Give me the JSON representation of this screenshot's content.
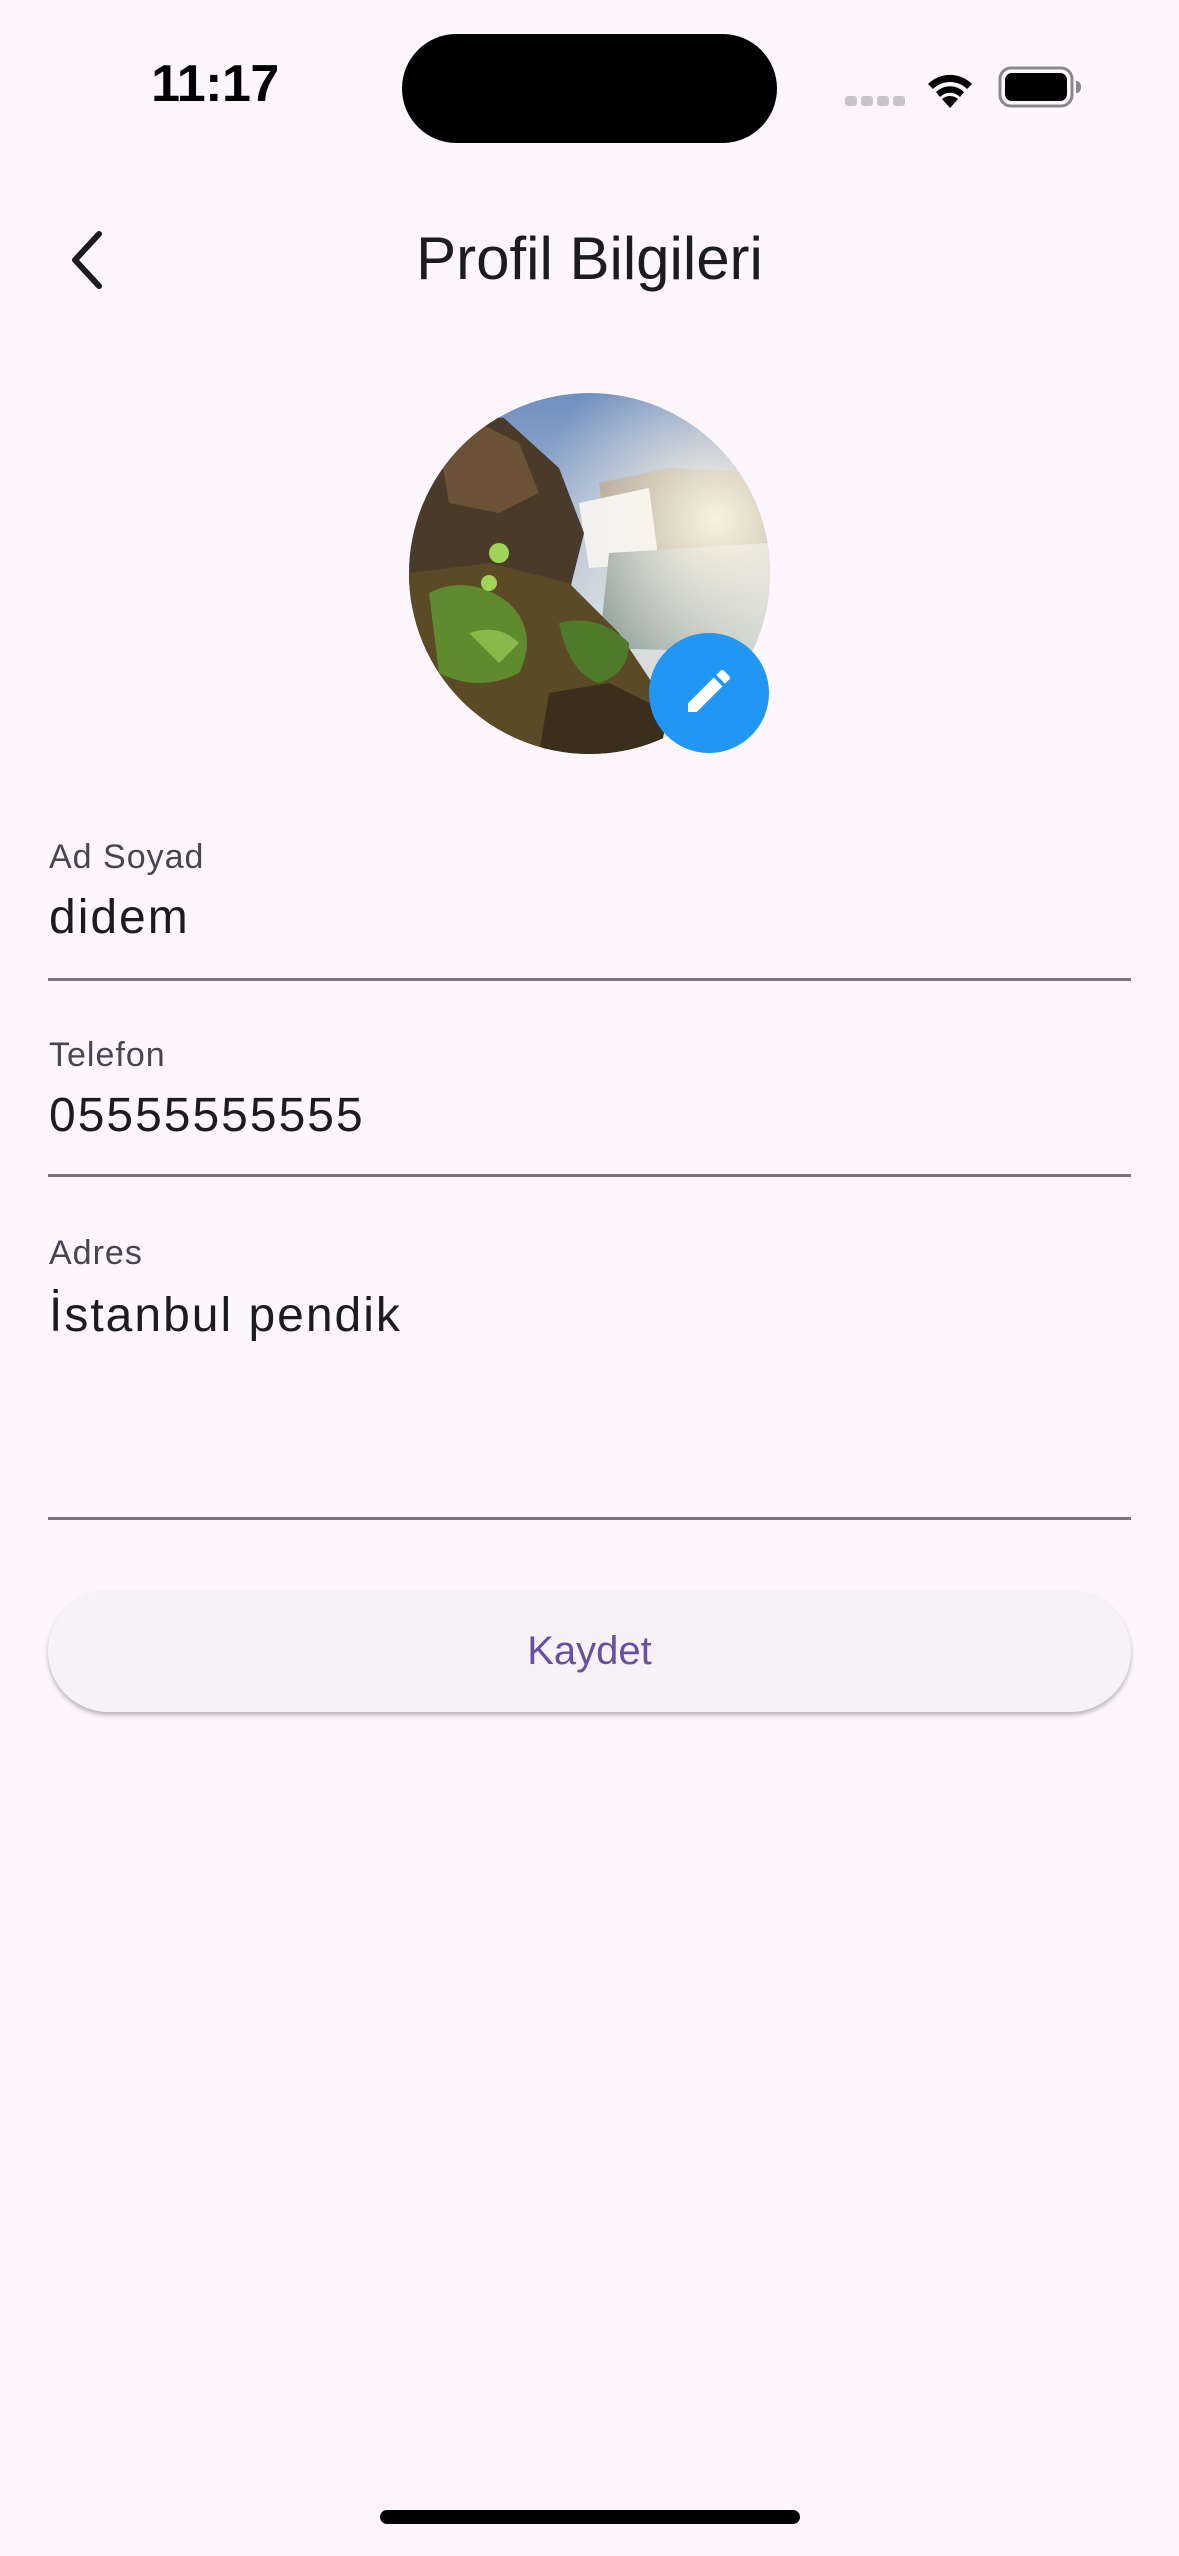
{
  "status_bar": {
    "time": "11:17",
    "icons": [
      "signal-icon",
      "wifi-icon",
      "battery-icon"
    ]
  },
  "header": {
    "title": "Profil Bilgileri",
    "back_icon": "chevron-left-icon"
  },
  "avatar": {
    "edit_icon": "pencil-icon",
    "edit_button_color": "#2196f3"
  },
  "form": {
    "name": {
      "label": "Ad Soyad",
      "value": "didem"
    },
    "phone": {
      "label": "Telefon",
      "value": "05555555555"
    },
    "address": {
      "label": "Adres",
      "value": "İstanbul pendik"
    }
  },
  "save_button": {
    "label": "Kaydet",
    "color": "#6750a4"
  },
  "colors": {
    "background": "#fdf7fd",
    "accent": "#2196f3",
    "primary": "#6750a4"
  }
}
